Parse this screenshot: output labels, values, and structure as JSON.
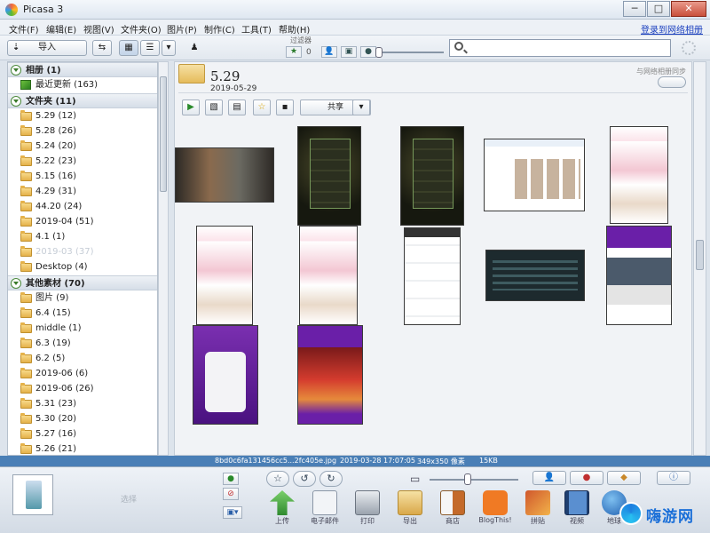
{
  "window": {
    "title": "Picasa 3",
    "controls": [
      "─",
      "□",
      "✕"
    ]
  },
  "menu": {
    "items": [
      "文件(F)",
      "编辑(E)",
      "视图(V)",
      "文件夹(O)",
      "图片(P)",
      "制作(C)",
      "工具(T)",
      "帮助(H)"
    ],
    "signin": "登录到网络相册"
  },
  "toolbar": {
    "import_label": "导入",
    "filter_label": "过滤器",
    "filter_count": "0"
  },
  "sidebar": {
    "sections": [
      {
        "label": "相册 (1)",
        "items": [
          {
            "label": "最近更新 (163)",
            "icon": "recent-icon"
          }
        ]
      },
      {
        "label": "文件夹 (11)",
        "items": [
          {
            "label": "5.29 (12)"
          },
          {
            "label": "5.28 (26)"
          },
          {
            "label": "5.24 (20)"
          },
          {
            "label": "5.22 (23)"
          },
          {
            "label": "5.15 (16)"
          },
          {
            "label": "4.29 (31)"
          },
          {
            "label": "44.20 (24)"
          },
          {
            "label": "2019-04 (51)"
          },
          {
            "label": "4.1 (1)"
          },
          {
            "label": "2019-03 (37)",
            "dim": true
          },
          {
            "label": "Desktop (4)"
          }
        ]
      },
      {
        "label": "其他素材 (70)",
        "items": [
          {
            "label": "图片 (9)"
          },
          {
            "label": "6.4 (15)"
          },
          {
            "label": "middle (1)"
          },
          {
            "label": "6.3 (19)"
          },
          {
            "label": "6.2 (5)"
          },
          {
            "label": "2019-06 (6)"
          },
          {
            "label": "2019-06 (26)"
          },
          {
            "label": "5.31 (23)"
          },
          {
            "label": "5.30 (20)"
          },
          {
            "label": "5.27 (16)"
          },
          {
            "label": "5.26 (21)"
          }
        ]
      }
    ]
  },
  "album": {
    "title": "5.29",
    "date": "2019-05-29",
    "sync_label": "与网络相册同步",
    "share_label": "共享"
  },
  "status": {
    "filename": "8bd0c6fa131456cc5...2fc405e.jpg",
    "datetime": "2019-03-28 17:07:05",
    "dimensions": "349x350 像素",
    "size": "15KB"
  },
  "tray": {
    "note": "选择",
    "tools": [
      {
        "label": "上传",
        "icon": "upload-icon",
        "color": "#3aa83a"
      },
      {
        "label": "电子邮件",
        "icon": "email-icon",
        "color": "#dfe4ea"
      },
      {
        "label": "打印",
        "icon": "print-icon",
        "color": "#c9ced6"
      },
      {
        "label": "导出",
        "icon": "export-folder-icon",
        "color": "#e6c06a"
      },
      {
        "label": "商店",
        "icon": "shop-icon",
        "color": "#bd6a2a"
      },
      {
        "label": "BlogThis!",
        "icon": "blogger-icon",
        "color": "#f07a24"
      },
      {
        "label": "拼贴",
        "icon": "collage-icon",
        "color": "#d0582c"
      },
      {
        "label": "视频",
        "icon": "movie-icon",
        "color": "#2a6ebf"
      },
      {
        "label": "地球",
        "icon": "earth-icon",
        "color": "#1f5fb0"
      }
    ]
  },
  "watermark": {
    "text": "嗨游网"
  }
}
